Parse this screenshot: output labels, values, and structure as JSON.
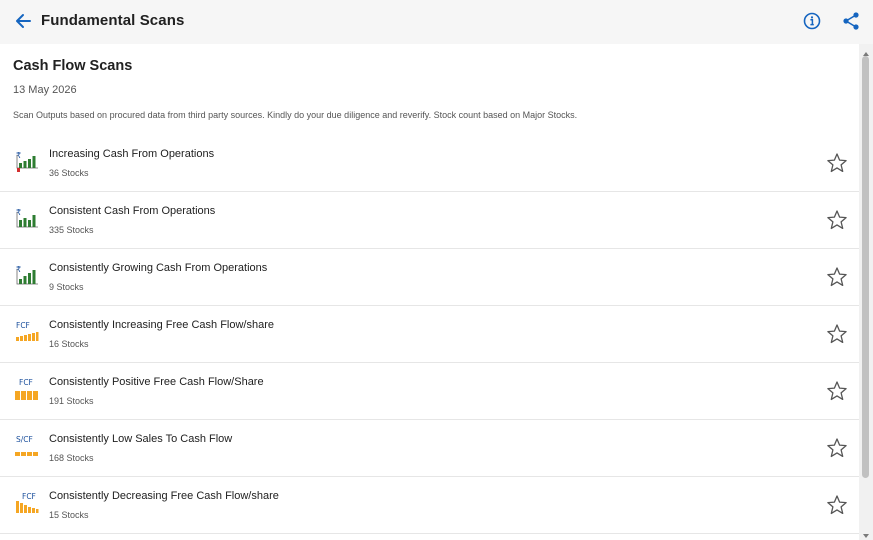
{
  "header": {
    "title": "Fundamental Scans",
    "back_icon": "arrow-left-icon",
    "info_icon": "info-circle-icon",
    "share_icon": "share-icon",
    "accent_color": "#1565c0"
  },
  "section": {
    "title": "Cash Flow Scans",
    "date": "13 May 2026",
    "disclaimer": "Scan Outputs based on procured data from third party sources. Kindly do your due diligence and reverify. Stock count based on Major Stocks."
  },
  "scans": [
    {
      "name": "Increasing Cash From Operations",
      "count": "36 Stocks",
      "icon": "rupee-bar-chart-icon"
    },
    {
      "name": "Consistent Cash From Operations",
      "count": "335 Stocks",
      "icon": "rupee-bar-chart-icon"
    },
    {
      "name": "Consistently Growing Cash From Operations",
      "count": "9 Stocks",
      "icon": "rupee-bar-chart-icon"
    },
    {
      "name": "Consistently Increasing Free Cash Flow/share",
      "count": "16 Stocks",
      "icon": "fcf-bar-chart-icon"
    },
    {
      "name": "Consistently Positive Free Cash Flow/Share",
      "count": "191 Stocks",
      "icon": "fcf-bar-chart-icon"
    },
    {
      "name": "Consistently Low Sales To Cash Flow",
      "count": "168 Stocks",
      "icon": "scf-bar-chart-icon"
    },
    {
      "name": "Consistently Decreasing Free Cash Flow/share",
      "count": "15 Stocks",
      "icon": "fcf-bar-chart-icon"
    }
  ],
  "icon_labels": {
    "fcf": "FCF",
    "scf": "S/CF",
    "rupee": "₹"
  },
  "colors": {
    "green": "#2e7d32",
    "red": "#d32f2f",
    "orange": "#f5a623",
    "label_blue": "#1a4f9c"
  }
}
